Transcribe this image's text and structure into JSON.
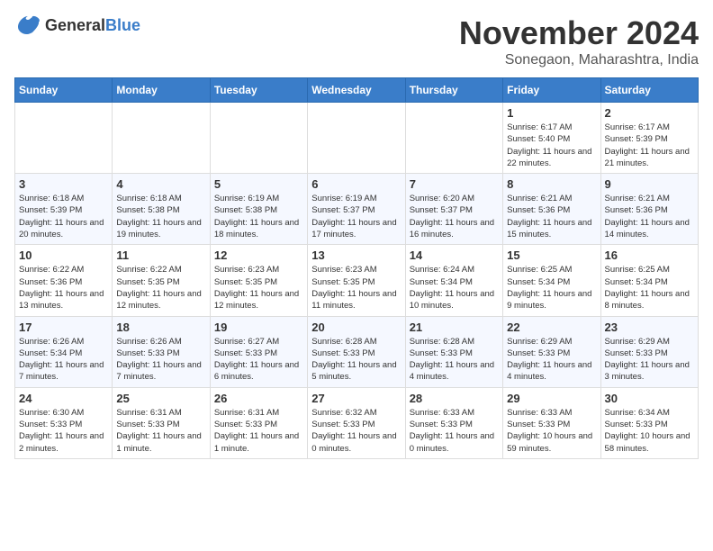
{
  "logo": {
    "general": "General",
    "blue": "Blue"
  },
  "title": "November 2024",
  "location": "Sonegaon, Maharashtra, India",
  "headers": [
    "Sunday",
    "Monday",
    "Tuesday",
    "Wednesday",
    "Thursday",
    "Friday",
    "Saturday"
  ],
  "weeks": [
    [
      {
        "day": "",
        "sunrise": "",
        "sunset": "",
        "daylight": ""
      },
      {
        "day": "",
        "sunrise": "",
        "sunset": "",
        "daylight": ""
      },
      {
        "day": "",
        "sunrise": "",
        "sunset": "",
        "daylight": ""
      },
      {
        "day": "",
        "sunrise": "",
        "sunset": "",
        "daylight": ""
      },
      {
        "day": "",
        "sunrise": "",
        "sunset": "",
        "daylight": ""
      },
      {
        "day": "1",
        "sunrise": "Sunrise: 6:17 AM",
        "sunset": "Sunset: 5:40 PM",
        "daylight": "Daylight: 11 hours and 22 minutes."
      },
      {
        "day": "2",
        "sunrise": "Sunrise: 6:17 AM",
        "sunset": "Sunset: 5:39 PM",
        "daylight": "Daylight: 11 hours and 21 minutes."
      }
    ],
    [
      {
        "day": "3",
        "sunrise": "Sunrise: 6:18 AM",
        "sunset": "Sunset: 5:39 PM",
        "daylight": "Daylight: 11 hours and 20 minutes."
      },
      {
        "day": "4",
        "sunrise": "Sunrise: 6:18 AM",
        "sunset": "Sunset: 5:38 PM",
        "daylight": "Daylight: 11 hours and 19 minutes."
      },
      {
        "day": "5",
        "sunrise": "Sunrise: 6:19 AM",
        "sunset": "Sunset: 5:38 PM",
        "daylight": "Daylight: 11 hours and 18 minutes."
      },
      {
        "day": "6",
        "sunrise": "Sunrise: 6:19 AM",
        "sunset": "Sunset: 5:37 PM",
        "daylight": "Daylight: 11 hours and 17 minutes."
      },
      {
        "day": "7",
        "sunrise": "Sunrise: 6:20 AM",
        "sunset": "Sunset: 5:37 PM",
        "daylight": "Daylight: 11 hours and 16 minutes."
      },
      {
        "day": "8",
        "sunrise": "Sunrise: 6:21 AM",
        "sunset": "Sunset: 5:36 PM",
        "daylight": "Daylight: 11 hours and 15 minutes."
      },
      {
        "day": "9",
        "sunrise": "Sunrise: 6:21 AM",
        "sunset": "Sunset: 5:36 PM",
        "daylight": "Daylight: 11 hours and 14 minutes."
      }
    ],
    [
      {
        "day": "10",
        "sunrise": "Sunrise: 6:22 AM",
        "sunset": "Sunset: 5:36 PM",
        "daylight": "Daylight: 11 hours and 13 minutes."
      },
      {
        "day": "11",
        "sunrise": "Sunrise: 6:22 AM",
        "sunset": "Sunset: 5:35 PM",
        "daylight": "Daylight: 11 hours and 12 minutes."
      },
      {
        "day": "12",
        "sunrise": "Sunrise: 6:23 AM",
        "sunset": "Sunset: 5:35 PM",
        "daylight": "Daylight: 11 hours and 12 minutes."
      },
      {
        "day": "13",
        "sunrise": "Sunrise: 6:23 AM",
        "sunset": "Sunset: 5:35 PM",
        "daylight": "Daylight: 11 hours and 11 minutes."
      },
      {
        "day": "14",
        "sunrise": "Sunrise: 6:24 AM",
        "sunset": "Sunset: 5:34 PM",
        "daylight": "Daylight: 11 hours and 10 minutes."
      },
      {
        "day": "15",
        "sunrise": "Sunrise: 6:25 AM",
        "sunset": "Sunset: 5:34 PM",
        "daylight": "Daylight: 11 hours and 9 minutes."
      },
      {
        "day": "16",
        "sunrise": "Sunrise: 6:25 AM",
        "sunset": "Sunset: 5:34 PM",
        "daylight": "Daylight: 11 hours and 8 minutes."
      }
    ],
    [
      {
        "day": "17",
        "sunrise": "Sunrise: 6:26 AM",
        "sunset": "Sunset: 5:34 PM",
        "daylight": "Daylight: 11 hours and 7 minutes."
      },
      {
        "day": "18",
        "sunrise": "Sunrise: 6:26 AM",
        "sunset": "Sunset: 5:33 PM",
        "daylight": "Daylight: 11 hours and 7 minutes."
      },
      {
        "day": "19",
        "sunrise": "Sunrise: 6:27 AM",
        "sunset": "Sunset: 5:33 PM",
        "daylight": "Daylight: 11 hours and 6 minutes."
      },
      {
        "day": "20",
        "sunrise": "Sunrise: 6:28 AM",
        "sunset": "Sunset: 5:33 PM",
        "daylight": "Daylight: 11 hours and 5 minutes."
      },
      {
        "day": "21",
        "sunrise": "Sunrise: 6:28 AM",
        "sunset": "Sunset: 5:33 PM",
        "daylight": "Daylight: 11 hours and 4 minutes."
      },
      {
        "day": "22",
        "sunrise": "Sunrise: 6:29 AM",
        "sunset": "Sunset: 5:33 PM",
        "daylight": "Daylight: 11 hours and 4 minutes."
      },
      {
        "day": "23",
        "sunrise": "Sunrise: 6:29 AM",
        "sunset": "Sunset: 5:33 PM",
        "daylight": "Daylight: 11 hours and 3 minutes."
      }
    ],
    [
      {
        "day": "24",
        "sunrise": "Sunrise: 6:30 AM",
        "sunset": "Sunset: 5:33 PM",
        "daylight": "Daylight: 11 hours and 2 minutes."
      },
      {
        "day": "25",
        "sunrise": "Sunrise: 6:31 AM",
        "sunset": "Sunset: 5:33 PM",
        "daylight": "Daylight: 11 hours and 1 minute."
      },
      {
        "day": "26",
        "sunrise": "Sunrise: 6:31 AM",
        "sunset": "Sunset: 5:33 PM",
        "daylight": "Daylight: 11 hours and 1 minute."
      },
      {
        "day": "27",
        "sunrise": "Sunrise: 6:32 AM",
        "sunset": "Sunset: 5:33 PM",
        "daylight": "Daylight: 11 hours and 0 minutes."
      },
      {
        "day": "28",
        "sunrise": "Sunrise: 6:33 AM",
        "sunset": "Sunset: 5:33 PM",
        "daylight": "Daylight: 11 hours and 0 minutes."
      },
      {
        "day": "29",
        "sunrise": "Sunrise: 6:33 AM",
        "sunset": "Sunset: 5:33 PM",
        "daylight": "Daylight: 10 hours and 59 minutes."
      },
      {
        "day": "30",
        "sunrise": "Sunrise: 6:34 AM",
        "sunset": "Sunset: 5:33 PM",
        "daylight": "Daylight: 10 hours and 58 minutes."
      }
    ]
  ]
}
